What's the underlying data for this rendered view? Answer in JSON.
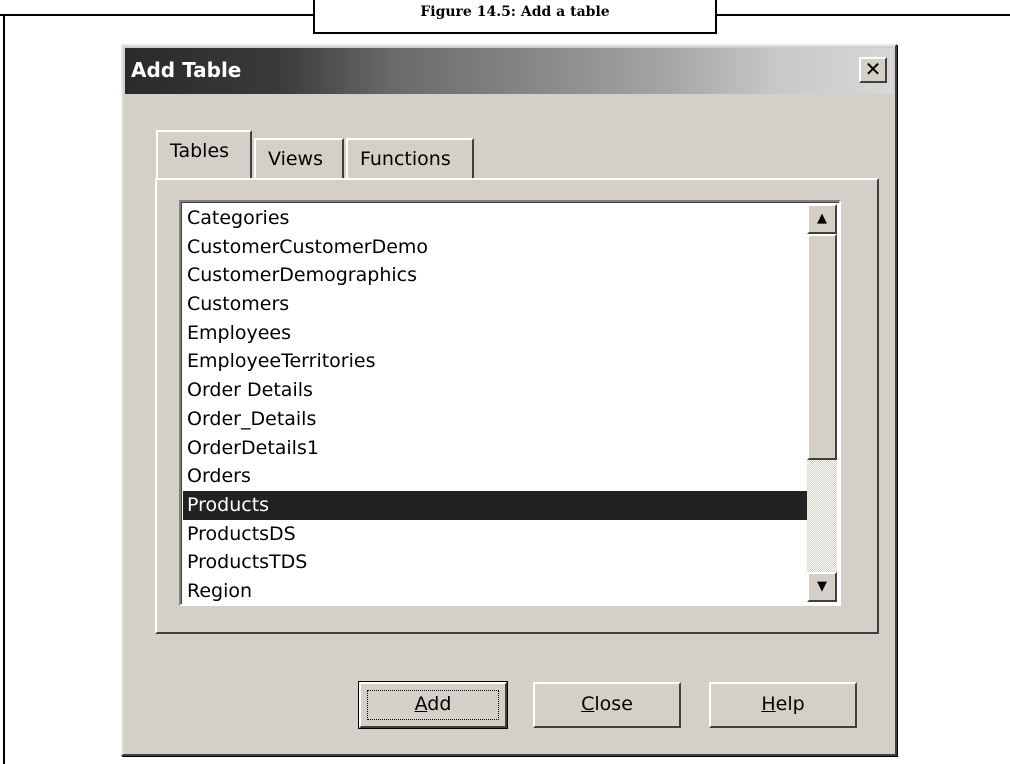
{
  "figure": {
    "caption": "Figure 14.5: Add a table"
  },
  "dialog": {
    "title": "Add Table",
    "close_symbol": "✕",
    "tabs": [
      {
        "label": "Tables",
        "active": true
      },
      {
        "label": "Views",
        "active": false
      },
      {
        "label": "Functions",
        "active": false
      }
    ],
    "list_items": [
      "Categories",
      "CustomerCustomerDemo",
      "CustomerDemographics",
      "Customers",
      "Employees",
      "EmployeeTerritories",
      "Order Details",
      "Order_Details",
      "OrderDetails1",
      "Orders",
      "Products",
      "ProductsDS",
      "ProductsTDS",
      "Region"
    ],
    "selected_item": "Products",
    "buttons": {
      "add": {
        "accel": "A",
        "rest": "dd"
      },
      "close": {
        "accel": "C",
        "rest": "lose"
      },
      "help": {
        "accel": "H",
        "rest": "elp"
      }
    }
  },
  "colors": {
    "dialog_face": "#d4d0c8",
    "selection": "#222222"
  },
  "icons": {
    "scroll_up": "triangle-up-icon",
    "scroll_down": "triangle-down-icon",
    "close": "close-icon"
  }
}
